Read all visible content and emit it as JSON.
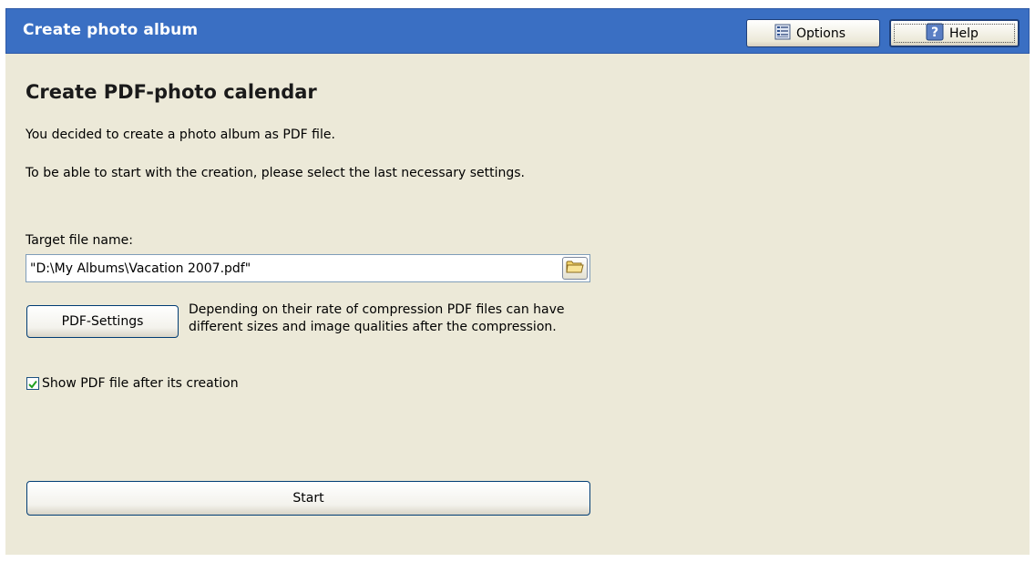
{
  "header": {
    "title": "Create photo album",
    "options_label": "Options",
    "help_label": "Help",
    "bar_color": "#3a6fc3"
  },
  "main": {
    "page_title": "Create PDF-photo calendar",
    "intro_line_1": "You decided to create a photo album as PDF file.",
    "intro_line_2": "To be able to start with the creation, please select the last necessary settings.",
    "target_label": "Target file name:",
    "target_value": "\"D:\\My Albums\\Vacation 2007.pdf\"",
    "pdf_settings_label": "PDF-Settings",
    "compression_note": "Depending on their rate of compression PDF files can have different sizes and image qualities after the compression.",
    "show_pdf_label": "Show PDF file after its creation",
    "show_pdf_checked": true,
    "start_label": "Start"
  },
  "icons": {
    "options": "list-icon",
    "help": "help-icon",
    "browse": "folder-icon",
    "checkbox": "checkmark-icon"
  }
}
